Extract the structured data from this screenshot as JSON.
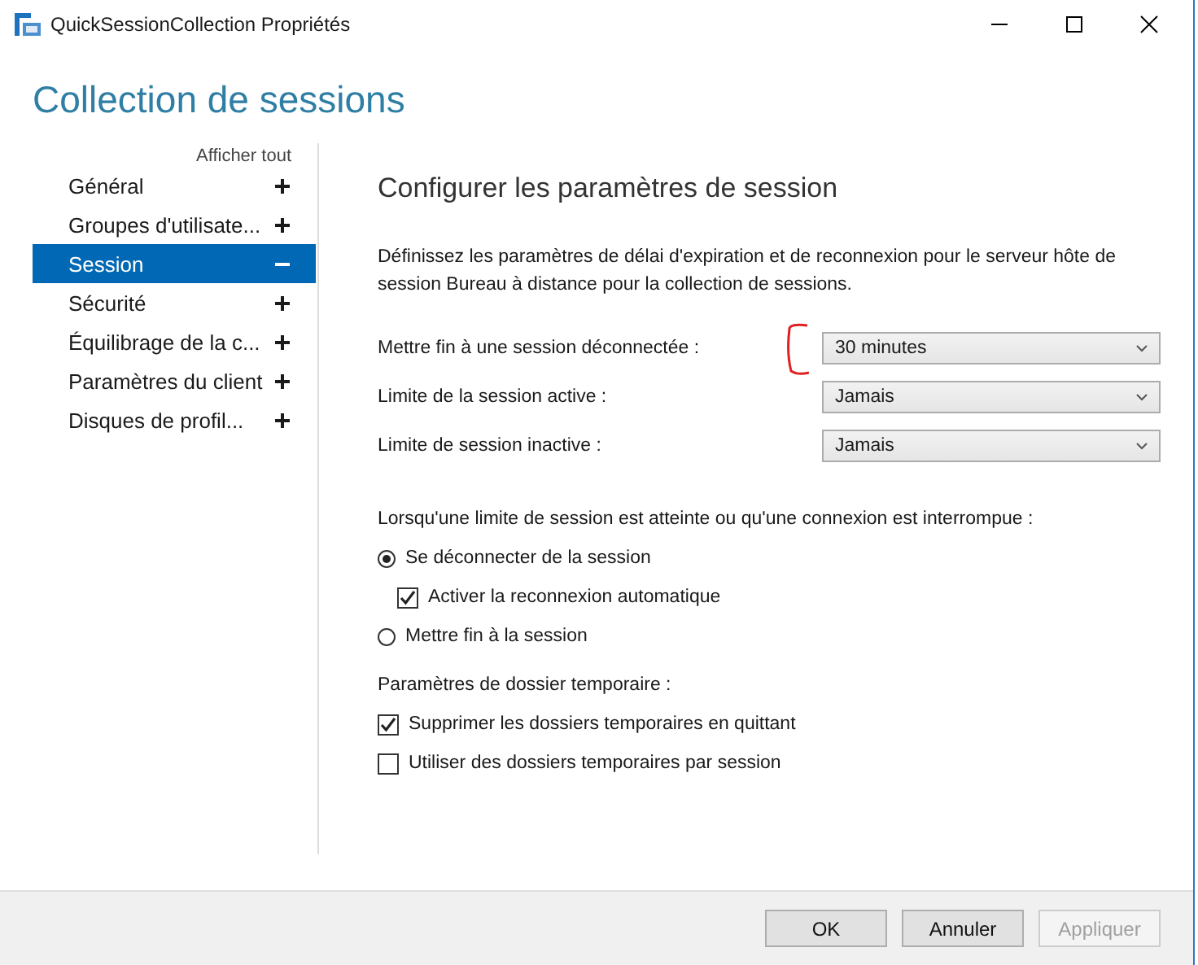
{
  "window": {
    "title": "QuickSessionCollection Propriétés"
  },
  "heading": "Collection de sessions",
  "sidebar": {
    "show_all": "Afficher tout",
    "items": [
      {
        "label": "Général",
        "expanded": false,
        "selected": false
      },
      {
        "label": "Groupes d'utilisate...",
        "expanded": false,
        "selected": false
      },
      {
        "label": "Session",
        "expanded": true,
        "selected": true
      },
      {
        "label": "Sécurité",
        "expanded": false,
        "selected": false
      },
      {
        "label": "Équilibrage de la c...",
        "expanded": false,
        "selected": false
      },
      {
        "label": "Paramètres du client",
        "expanded": false,
        "selected": false
      },
      {
        "label": "Disques de profil...",
        "expanded": false,
        "selected": false
      }
    ]
  },
  "section": {
    "title": "Configurer les paramètres de session",
    "description": "Définissez les paramètres de délai d'expiration et de reconnexion pour le serveur hôte de session Bureau à distance pour la collection de sessions.",
    "settings": [
      {
        "label": "Mettre fin à une session déconnectée :",
        "value": "30 minutes",
        "annotated": true
      },
      {
        "label": "Limite de la session active :",
        "value": "Jamais",
        "annotated": false
      },
      {
        "label": "Limite de session inactive :",
        "value": "Jamais",
        "annotated": false
      }
    ],
    "limit_heading": "Lorsqu'une limite de session est atteinte ou qu'une connexion est interrompue :",
    "limit_options": [
      {
        "kind": "radio",
        "label": "Se déconnecter de la session",
        "selected": true,
        "children": [
          {
            "kind": "checkbox",
            "label": "Activer la reconnexion automatique",
            "checked": true
          }
        ]
      },
      {
        "kind": "radio",
        "label": "Mettre fin à la session",
        "selected": false
      }
    ],
    "temp_heading": "Paramètres de dossier temporaire :",
    "temp_options": [
      {
        "kind": "checkbox",
        "label": "Supprimer les dossiers temporaires en quittant",
        "checked": true
      },
      {
        "kind": "checkbox",
        "label": "Utiliser des dossiers temporaires par session",
        "checked": false
      }
    ]
  },
  "buttons": [
    {
      "label": "OK",
      "disabled": false
    },
    {
      "label": "Annuler",
      "disabled": false
    },
    {
      "label": "Appliquer",
      "disabled": true
    }
  ]
}
